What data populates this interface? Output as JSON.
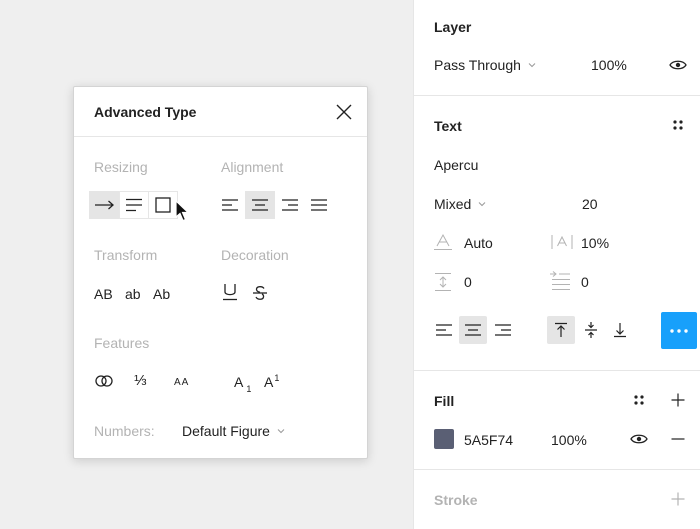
{
  "layer": {
    "title": "Layer",
    "blend_mode": "Pass Through",
    "opacity": "100%"
  },
  "text": {
    "title": "Text",
    "font_family": "Apercu",
    "font_weight": "Mixed",
    "font_size": "20",
    "line_height": "Auto",
    "letter_spacing": "10%",
    "paragraph_spacing": "0",
    "paragraph_indent": "0"
  },
  "fill": {
    "title": "Fill",
    "color_hex": "5A5F74",
    "color": "#5A5F74",
    "opacity": "100%"
  },
  "stroke": {
    "title": "Stroke"
  },
  "popover": {
    "title": "Advanced Type",
    "resizing_label": "Resizing",
    "alignment_label": "Alignment",
    "transform_label": "Transform",
    "decoration_label": "Decoration",
    "features_label": "Features",
    "numbers_label": "Numbers:",
    "numbers_value": "Default Figure",
    "transform_options": [
      "AB",
      "ab",
      "Ab"
    ],
    "features": {
      "fraction": "⅓",
      "small_caps": "AA"
    },
    "subscript": {
      "base": "A",
      "mark": "1"
    },
    "superscript": {
      "base": "A",
      "mark": "1"
    }
  },
  "colors": {
    "accent": "#18A0FB",
    "selected_bg": "#E5E5E5"
  }
}
